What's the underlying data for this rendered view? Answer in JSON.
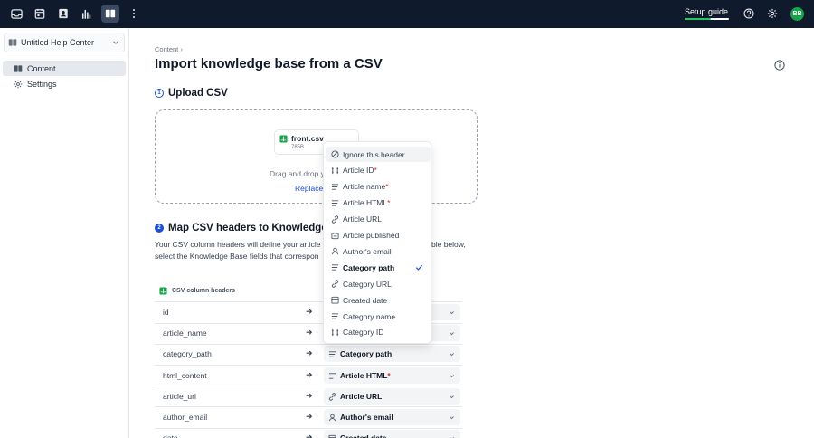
{
  "topbar": {
    "icons": [
      "inbox-icon",
      "calendar-icon",
      "contacts-icon",
      "reports-icon",
      "knowledge-base-icon",
      "more-icon"
    ],
    "setup_label": "Setup guide",
    "setup_progress": 0.6,
    "avatar": "BB"
  },
  "sidebar": {
    "help_center": "Untitled Help Center",
    "items": [
      {
        "label": "Content"
      },
      {
        "label": "Settings"
      }
    ]
  },
  "main": {
    "breadcrumb": "Content",
    "title": "Import knowledge base from a CSV",
    "step1": {
      "num": "1",
      "title": "Upload CSV"
    },
    "file": {
      "name": "front.csv",
      "size": "785B"
    },
    "drag_text": "Drag and drop y",
    "replace": "Replace",
    "step2": {
      "num": "2",
      "title": "Map CSV headers to Knowledge Ba"
    },
    "desc_line1": "Your CSV column headers will define your article",
    "desc_line1_right": "ble below,",
    "desc_line2": "select the Knowledge Base fields that correspon",
    "table_header": "CSV column headers",
    "rows": [
      {
        "name": "id",
        "field": "",
        "req": ""
      },
      {
        "name": "article_name",
        "field": "",
        "req": ""
      },
      {
        "name": "category_path",
        "field": "Category path",
        "req": ""
      },
      {
        "name": "html_content",
        "field": "Article HTML",
        "req": "*"
      },
      {
        "name": "article_url",
        "field": "Article URL",
        "req": ""
      },
      {
        "name": "author_email",
        "field": "Author's email",
        "req": ""
      },
      {
        "name": "date",
        "field": "Created date",
        "req": ""
      }
    ]
  },
  "menu": {
    "items": [
      {
        "label": "Ignore this header",
        "req": "",
        "icon": "ignore-icon"
      },
      {
        "label": "Article ID",
        "req": "*",
        "icon": "id-icon"
      },
      {
        "label": "Article name",
        "req": "*",
        "icon": "text-icon"
      },
      {
        "label": "Article HTML",
        "req": "*",
        "icon": "text-icon"
      },
      {
        "label": "Article URL",
        "req": "",
        "icon": "link-icon"
      },
      {
        "label": "Article published",
        "req": "",
        "icon": "publish-icon"
      },
      {
        "label": "Author's email",
        "req": "",
        "icon": "person-icon"
      },
      {
        "label": "Category path",
        "req": "",
        "icon": "text-icon"
      },
      {
        "label": "Category URL",
        "req": "",
        "icon": "link-icon"
      },
      {
        "label": "Created date",
        "req": "",
        "icon": "calendar-icon"
      },
      {
        "label": "Category name",
        "req": "",
        "icon": "text-icon"
      },
      {
        "label": "Category ID",
        "req": "",
        "icon": "id-icon"
      }
    ],
    "selected": "Category path"
  }
}
